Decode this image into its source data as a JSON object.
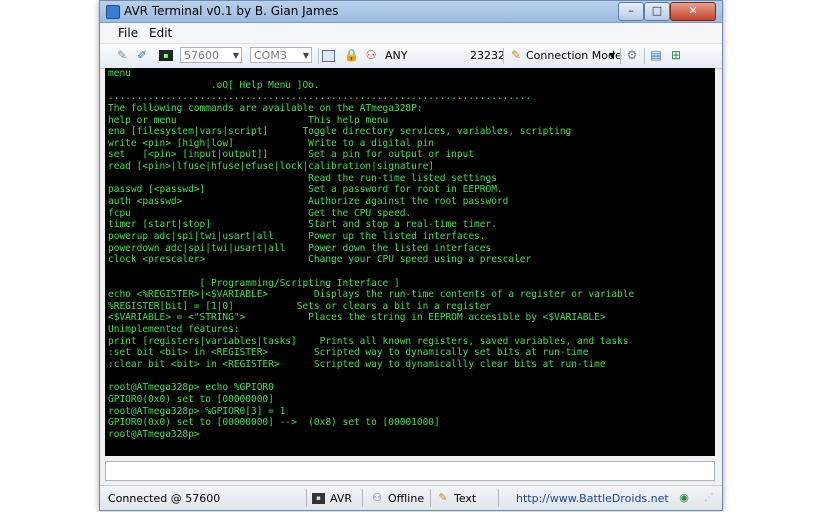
{
  "window": {
    "title": "AVR Terminal v0.1 by B. Gian James",
    "minimize_glyph": "–",
    "maximize_glyph": "□",
    "close_glyph": "✕"
  },
  "menu": {
    "items": [
      {
        "label": "File"
      },
      {
        "label": "Edit"
      }
    ]
  },
  "toolbar": {
    "baud_rate": "57600",
    "port": "COM3",
    "address": "ANY",
    "tcp_port": "23232",
    "connection_mode_label": "Connection Mode",
    "icons": [
      "pencil-icon",
      "wand-icon",
      "terminal-icon",
      "window-icon",
      "lock-icon",
      "network-icon",
      "connection-mode-icon",
      "gear-icon",
      "notebook-icon",
      "tree-icon"
    ]
  },
  "terminal": {
    "lines": [
      "menu",
      "                  .oO[ Help Menu ]Oo.",
      "..........................................................................",
      "The following commands are available on the ATmega328P:",
      "help or menu                       This help menu",
      "ena [filesystem|vars|script]      Toggle directory services, variables, scripting",
      "write <pin> [high|low]             Write to a digital pin",
      "set   [<pin> [input|output]]       Set a pin for output or input",
      "read [<pin>|lfuse|hfuse|efuse|lock|calibration|signature]",
      "                                   Read the run-time listed settings",
      "passwd [<passwd>]                  Set a password for root in EEPROM.",
      "auth <passwd>                      Authorize against the root password",
      "fcpu                               Get the CPU speed.",
      "timer [start|stop]                 Start and stop a real-time timer.",
      "powerup adc|spi|twi|usart|all      Power up the listed interfaces.",
      "powerdown adc|spi|twi|usart|all    Power down the listed interfaces",
      "clock <prescaler>                  Change your CPU speed using a prescaler",
      "",
      "                [ Programming/Scripting Interface ]",
      "echo <%REGISTER>|<$VARIABLE>        Displays the run-time contents of a register or variable",
      "%REGISTER[bit] = [1|0]           Sets or clears a bit in a register",
      "<$VARIABLE> = <\"STRING\">           Places the string in EEPROM accesible by <$VARIABLE>",
      "Unimplemented features:",
      "print [registers|variables|tasks]    Prints all known registers, saved variables, and tasks",
      ":set bit <bit> in <REGISTER>        Scripted way to dynamically set bits at run-time",
      ":clear bit <bit> in <REGISTER>      Scripted way to dynamicallly clear bits at run-time",
      "",
      "root@ATmega328p> echo %GPIOR0",
      "GPIOR0(0x0) set to [00000000]",
      "root@ATmega328p> %GPIOR0[3] = 1",
      "GPIOR0(0x0) set to [00000000] -->  (0x8) set to [00001000]",
      "root@ATmega328p>"
    ]
  },
  "input": {
    "value": ""
  },
  "status": {
    "connection": "Connected @ 57600",
    "device": "AVR",
    "mode": "Offline",
    "format": "Text",
    "url": "http://www.BattleDroids.net"
  },
  "colors": {
    "terminal_background": "#000000",
    "terminal_text": "#3ce04a",
    "link": "#1a46a8"
  }
}
